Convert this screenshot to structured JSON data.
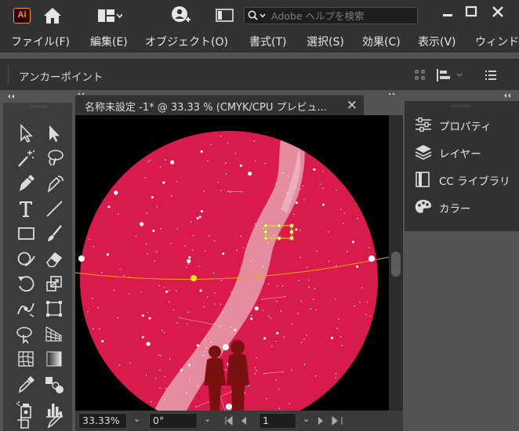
{
  "app": {
    "logo_text": "Ai",
    "search_placeholder": "Adobe ヘルプを検索"
  },
  "menu": [
    "ファイル(F)",
    "編集(E)",
    "オブジェクト(O)",
    "書式(T)",
    "選択(S)",
    "効果(C)",
    "表示(V)",
    "ウィンド"
  ],
  "control_bar": {
    "label": "アンカーポイント"
  },
  "document": {
    "tab_title": "名称未設定 -1* @ 33.33 % (CMYK/CPU プレビュ...",
    "close_glyph": "×",
    "colors": {
      "sky": "#d81b4a",
      "milky_way": "#e8a0b0",
      "ecliptic": "#f2a300",
      "selection": "#e8e800"
    }
  },
  "status": {
    "zoom": "33.33%",
    "rotation": "0°",
    "artboard": "1"
  },
  "right_panel": {
    "items": [
      {
        "label": "プロパティ",
        "icon": "properties-icon"
      },
      {
        "label": "レイヤー",
        "icon": "layers-icon"
      },
      {
        "label": "CC ライブラリ",
        "icon": "libraries-icon"
      },
      {
        "label": "カラー",
        "icon": "color-palette-icon"
      }
    ]
  },
  "icons": {
    "home": "home-icon",
    "workspace": "workspace-layout-icon",
    "user": "add-user-icon",
    "panel": "panel-toggle-icon"
  }
}
